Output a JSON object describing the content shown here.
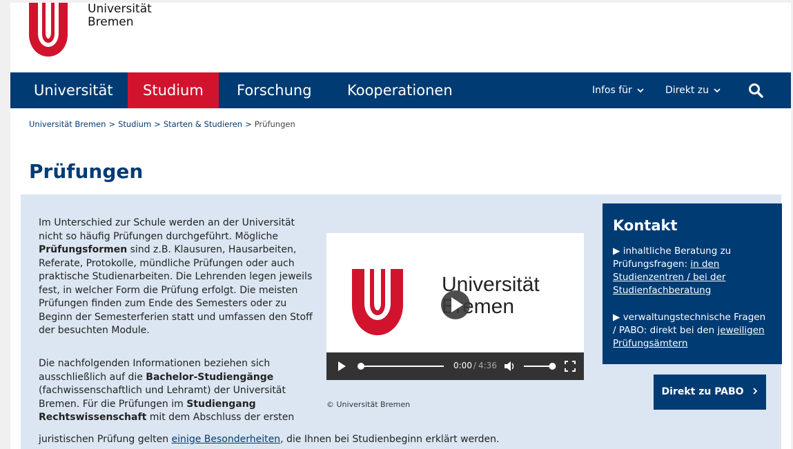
{
  "brand": {
    "line1": "Universität",
    "line2": "Bremen",
    "red": "#d2132e",
    "blue": "#003b73"
  },
  "nav": {
    "items": [
      {
        "label": "Universität",
        "active": false
      },
      {
        "label": "Studium",
        "active": true
      },
      {
        "label": "Forschung",
        "active": false
      },
      {
        "label": "Kooperationen",
        "active": false
      }
    ],
    "infos_label": "Infos für",
    "direkt_label": "Direkt zu",
    "search_icon": "search-icon"
  },
  "breadcrumb": [
    "Universität Bremen",
    "Studium",
    "Starten & Studieren",
    "Prüfungen"
  ],
  "page": {
    "title": "Prüfungen"
  },
  "content": {
    "p1_a": "Im Unterschied zur Schule werden an der Universität nicht so häufig Prüfungen durchgeführt. Mögliche ",
    "p1_bold": "Prüfungsformen",
    "p1_b": " sind z.B. Klausuren, Hausarbeiten, Referate, Protokolle, mündliche Prüfungen oder auch praktische Studienarbeiten. Die Lehrenden legen jeweils fest, in welcher Form die Prüfung erfolgt. Die meisten Prüfungen finden zum Ende des Semesters oder zu Beginn der Semesterferien statt und umfassen den Stoff der besuchten Module.",
    "p2_a": "Die nachfolgenden Informationen beziehen sich ausschließlich auf die ",
    "p2_bold1": "Bachelor-Studiengänge",
    "p2_b": " (fachwissenschaftlich und Lehramt) der Universität Bremen. Für die Prüfungen im ",
    "p2_bold2": "Studiengang Rechtswissenschaft",
    "p2_c": " mit dem Abschluss der ersten",
    "p2_d": "juristischen Prüfung gelten ",
    "p2_link": "einige Besonderheiten",
    "p2_e": ", die Ihnen bei Studienbeginn erklärt werden."
  },
  "video": {
    "logo_line1": "Universität",
    "logo_line2": "Bremen",
    "time_current": "0:00",
    "time_sep": " / ",
    "time_total": "4:36",
    "progress": 0,
    "volume": 0.9,
    "credit": "© Universität Bremen"
  },
  "kontakt": {
    "title": "Kontakt",
    "item1_text": "inhaltliche Beratung zu Prüfungsfragen: ",
    "item1_link": "in den Studienzentren / bei der Studienfachberatung",
    "item2_text": "verwaltungstechnische Fragen / PABO: direkt bei den ",
    "item2_link": "jeweiligen Prüfungsämtern"
  },
  "pabo_button": {
    "label": "Direkt zu PABO"
  }
}
